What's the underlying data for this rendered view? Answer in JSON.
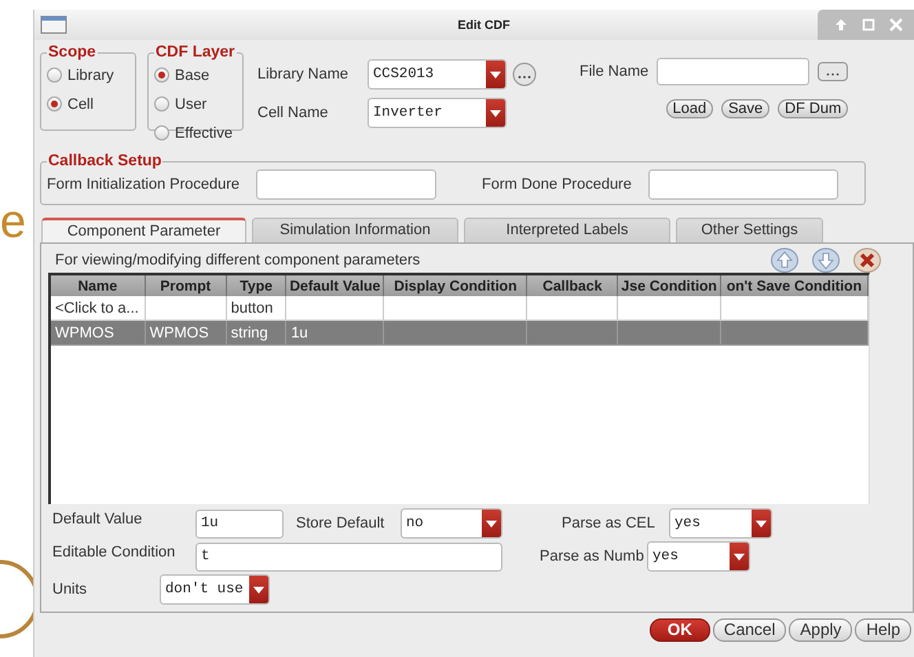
{
  "backdrop": {
    "letter": "e"
  },
  "window": {
    "title": "Edit CDF"
  },
  "scope": {
    "title": "Scope",
    "options": [
      {
        "label": "Library",
        "selected": false
      },
      {
        "label": "Cell",
        "selected": true
      }
    ]
  },
  "cdf_layer": {
    "title": "CDF Layer",
    "options": [
      {
        "label": "Base",
        "selected": true
      },
      {
        "label": "User",
        "selected": false
      },
      {
        "label": "Effective",
        "selected": false
      }
    ]
  },
  "library_name": {
    "label": "Library Name",
    "value": "CCS2013"
  },
  "cell_name": {
    "label": "Cell Name",
    "value": "Inverter"
  },
  "file_name": {
    "label": "File Name"
  },
  "file_buttons": [
    "Load",
    "Save",
    "DF Dum"
  ],
  "callback_setup": {
    "title": "Callback Setup",
    "fields": [
      {
        "label": "Form Initialization Procedure"
      },
      {
        "label": "Form Done Procedure"
      }
    ]
  },
  "tabs": [
    {
      "label": "Component Parameter",
      "selected": true
    },
    {
      "label": "Simulation Information",
      "selected": false
    },
    {
      "label": "Interpreted Labels",
      "selected": false
    },
    {
      "label": "Other Settings",
      "selected": false
    }
  ],
  "description": "For viewing/modifying different component parameters",
  "table": {
    "columns": [
      "Name",
      "Prompt",
      "Type",
      "Default Value",
      "Display Condition",
      "Callback",
      "Jse Condition",
      "on't Save Condition"
    ],
    "rows": [
      {
        "cells": [
          "<Click to a...",
          null,
          "button",
          null,
          null,
          null,
          null,
          null
        ],
        "selected": false
      },
      {
        "cells": [
          "WPMOS",
          "WPMOS",
          "string",
          "1u",
          null,
          null,
          null,
          null
        ],
        "selected": true
      }
    ]
  },
  "form": {
    "default_value": {
      "label": "Default Value",
      "value": "1u"
    },
    "store_default": {
      "label": "Store Default",
      "value": "no"
    },
    "parse_as_cel": {
      "label": "Parse as CEL",
      "value": "yes"
    },
    "editable_condition": {
      "label": "Editable Condition",
      "value": "t"
    },
    "parse_as_number": {
      "label": "Parse as Numb",
      "value": "yes"
    },
    "units": {
      "label": "Units",
      "value": "don't use"
    }
  },
  "buttons": [
    {
      "label": "OK",
      "kind": "primary"
    },
    {
      "label": "Cancel",
      "kind": "normal"
    },
    {
      "label": "Apply",
      "kind": "normal"
    },
    {
      "label": "Help",
      "kind": "normal"
    }
  ]
}
